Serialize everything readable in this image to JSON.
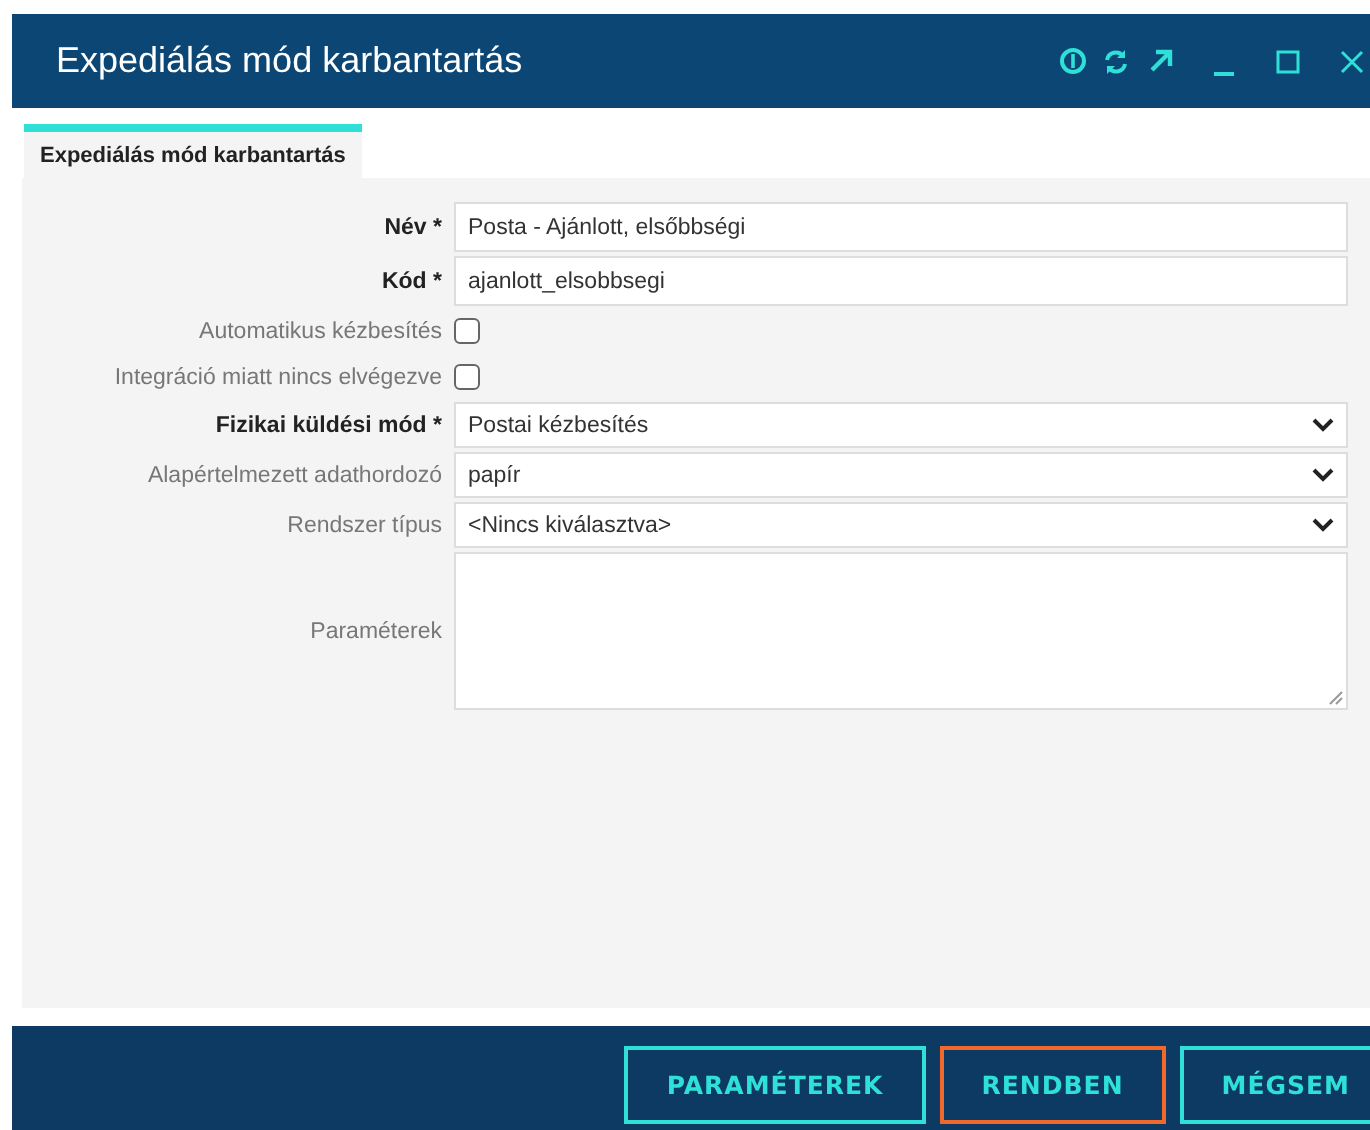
{
  "window": {
    "title": "Expediálás mód karbantartás"
  },
  "tabs": [
    {
      "label": "Expediálás mód karbantartás",
      "selected": true
    }
  ],
  "fields": [
    {
      "kind": "text",
      "label": "Név *",
      "required": true,
      "value": "Posta - Ajánlott, elsőbbségi"
    },
    {
      "kind": "text",
      "label": "Kód *",
      "required": true,
      "value": "ajanlott_elsobbsegi"
    },
    {
      "kind": "checkbox",
      "label": "Automatikus kézbesítés",
      "required": false,
      "checked": false
    },
    {
      "kind": "checkbox",
      "label": "Integráció miatt nincs elvégezve",
      "required": false,
      "checked": false
    },
    {
      "kind": "select",
      "label": "Fizikai küldési mód *",
      "required": true,
      "value": "Postai kézbesítés"
    },
    {
      "kind": "select",
      "label": "Alapértelmezett adathordozó",
      "required": false,
      "value": "papír"
    },
    {
      "kind": "select",
      "label": "Rendszer típus",
      "required": false,
      "value": "<Nincs kiválasztva>"
    },
    {
      "kind": "textarea",
      "label": "Paraméterek",
      "required": false
    }
  ],
  "buttons": [
    {
      "label": "PARAMÉTEREK",
      "focused": false
    },
    {
      "label": "RENDBEN",
      "focused": true
    },
    {
      "label": "MÉGSEM",
      "focused": false
    }
  ]
}
